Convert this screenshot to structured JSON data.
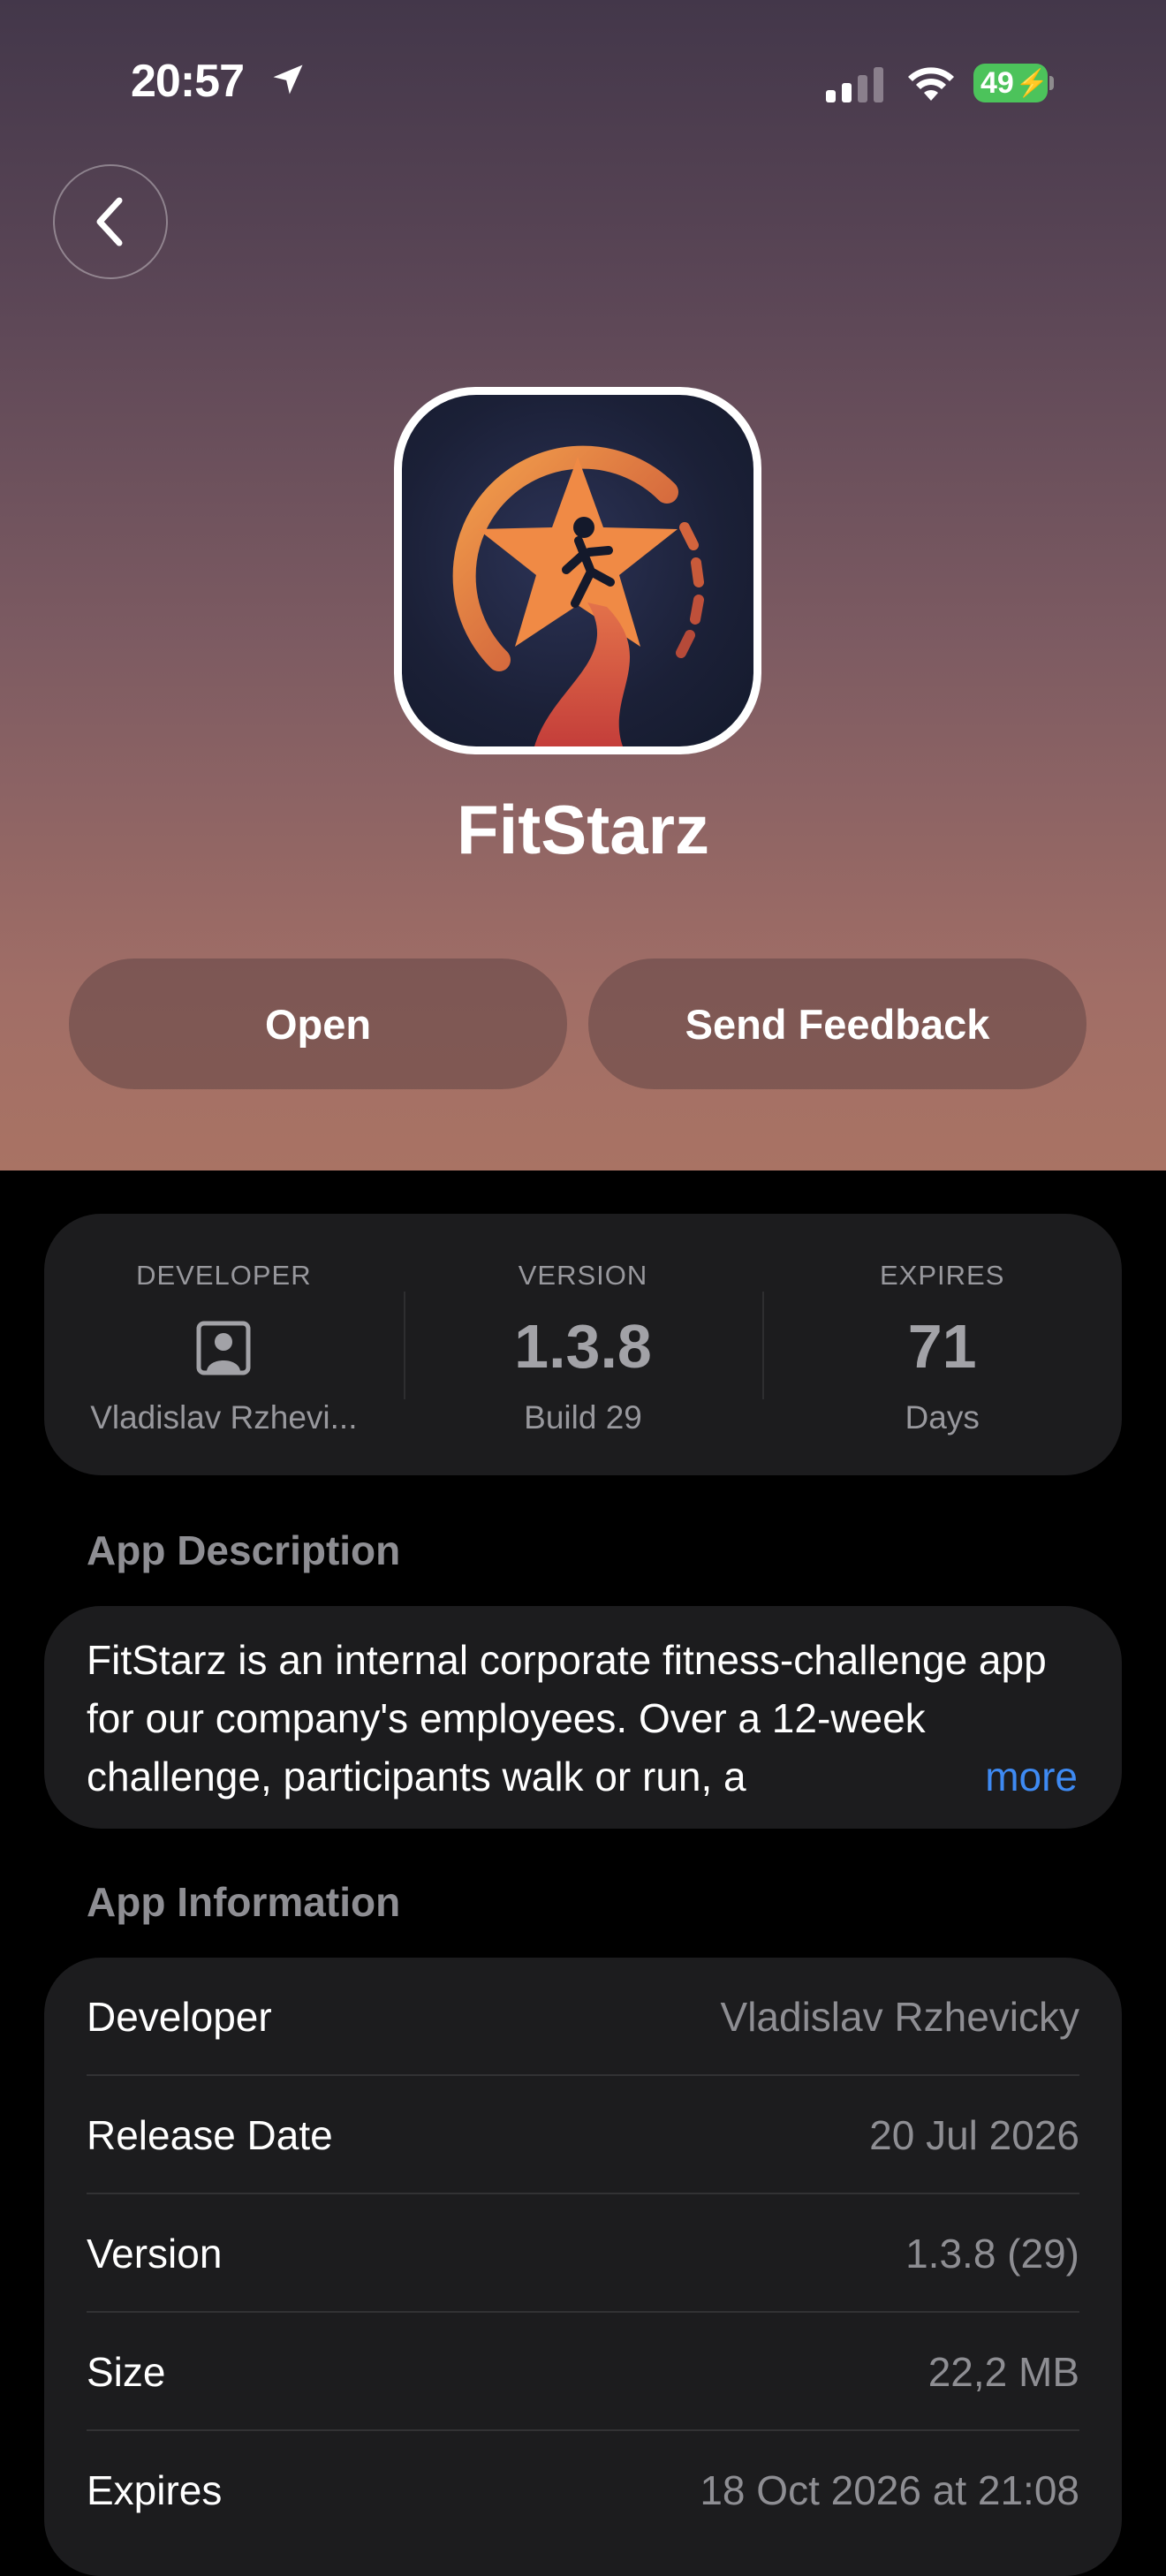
{
  "status_bar": {
    "time": "20:57",
    "battery": "49"
  },
  "app": {
    "name": "FitStarz"
  },
  "actions": {
    "open_label": "Open",
    "feedback_label": "Send Feedback"
  },
  "stats": {
    "developer": {
      "label": "DEVELOPER",
      "value": "Vladislav Rzhevi..."
    },
    "version": {
      "label": "VERSION",
      "value": "1.3.8",
      "sub": "Build 29"
    },
    "expires": {
      "label": "EXPIRES",
      "value": "71",
      "sub": "Days"
    }
  },
  "description": {
    "title": "App Description",
    "text": "FitStarz is an internal corporate fitness-challenge app for our company's employees. Over a 12-week challenge, participants walk or run, a",
    "more_label": "more"
  },
  "information": {
    "title": "App Information",
    "rows": [
      {
        "key": "Developer",
        "value": "Vladislav Rzhevicky"
      },
      {
        "key": "Release Date",
        "value": "20 Jul 2026"
      },
      {
        "key": "Version",
        "value": "1.3.8 (29)"
      },
      {
        "key": "Size",
        "value": "22,2 MB"
      },
      {
        "key": "Expires",
        "value": "18 Oct 2026 at 21:08"
      }
    ]
  },
  "colors": {
    "accent_link": "#3e8af3",
    "battery": "#4cc35b",
    "card": "#1c1c1e"
  },
  "icons": [
    "location-arrow-icon",
    "cellular-signal-icon",
    "wifi-icon",
    "battery-icon",
    "chevron-left-icon",
    "app-icon",
    "person-icon"
  ]
}
